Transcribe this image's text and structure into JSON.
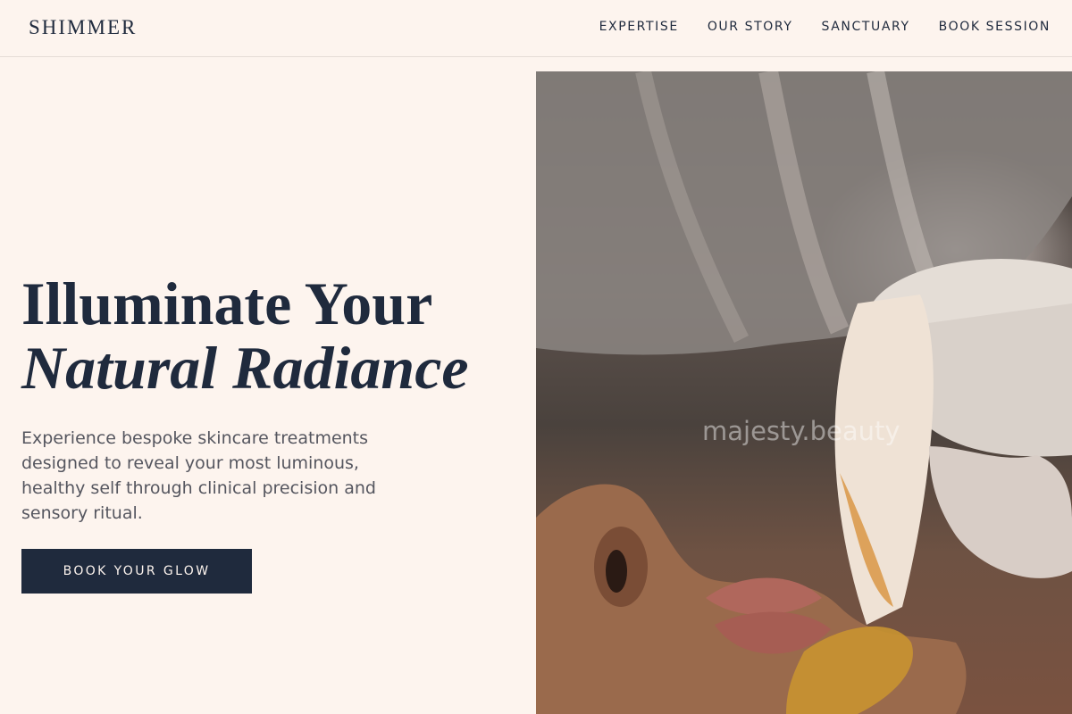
{
  "brand": {
    "logo": "SHIMMER"
  },
  "nav": {
    "items": [
      {
        "label": "EXPERTISE"
      },
      {
        "label": "OUR STORY"
      },
      {
        "label": "SANCTUARY"
      },
      {
        "label": "BOOK SESSION"
      }
    ]
  },
  "hero": {
    "title_line1": "Illuminate Your",
    "title_line2": "Natural Radiance",
    "description": "Experience bespoke skincare treatments designed to reveal your most luminous, healthy self through clinical precision and sensory ritual.",
    "cta_label": "BOOK YOUR GLOW",
    "watermark": "majesty.beauty"
  },
  "colors": {
    "background": "#fdf4ee",
    "primary": "#1f2a3d",
    "body_text": "#55565f"
  }
}
